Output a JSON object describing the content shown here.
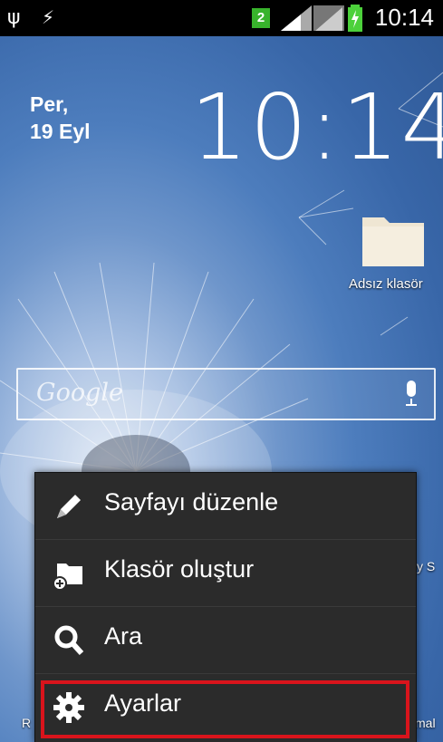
{
  "statusbar": {
    "notification_count": "2",
    "time": "10:14"
  },
  "home": {
    "date_day": "Per,",
    "date_date": "19 Eyl",
    "clock": "10:14",
    "folder_label": "Adsız klasör",
    "search_placeholder": "Google",
    "edge_left_1": "R",
    "edge_right_1": "y S",
    "edge_right_2": "mal"
  },
  "menu": {
    "items": [
      {
        "label": "Sayfayı düzenle",
        "icon": "pencil-icon"
      },
      {
        "label": "Klasör oluştur",
        "icon": "new-folder-icon"
      },
      {
        "label": "Ara",
        "icon": "search-icon"
      },
      {
        "label": "Ayarlar",
        "icon": "gear-icon"
      }
    ],
    "highlight_color": "#d9141c"
  }
}
